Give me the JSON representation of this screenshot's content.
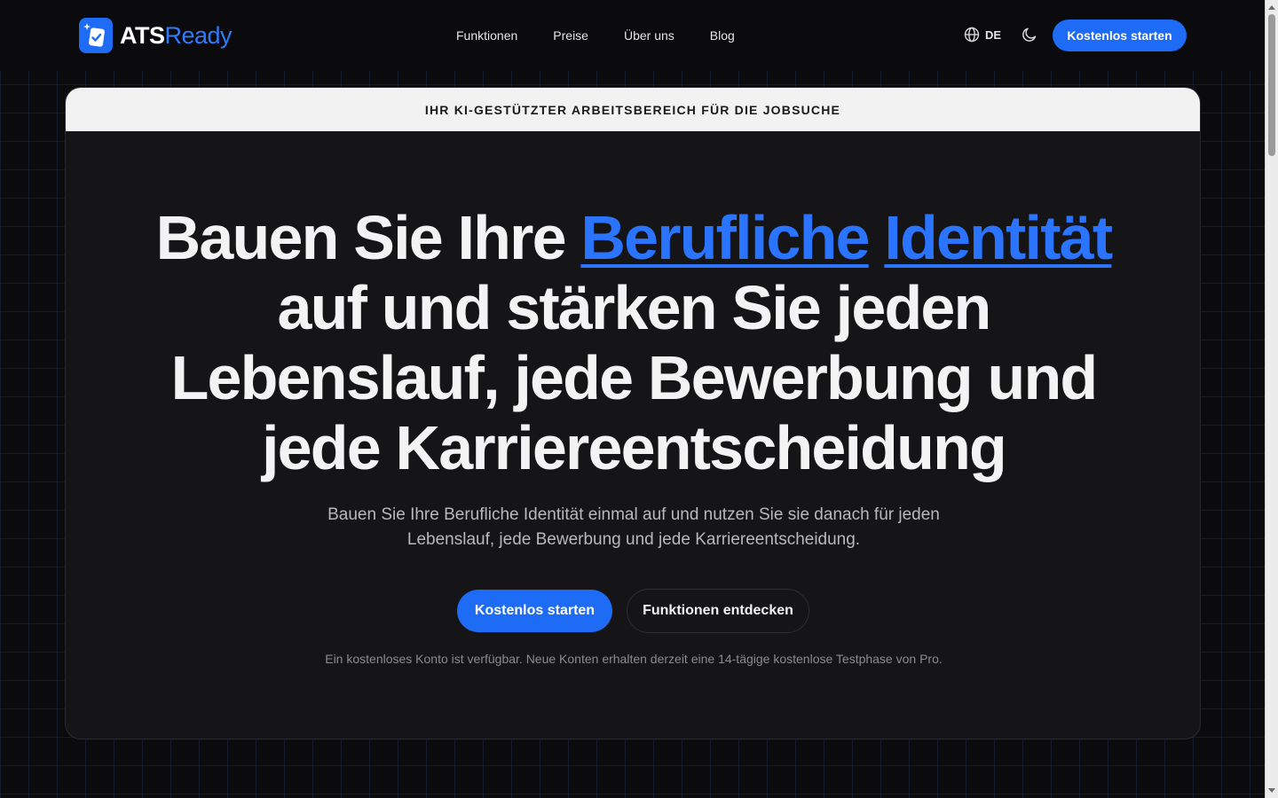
{
  "brand": {
    "name_part1": "ATS",
    "name_part2": "Ready"
  },
  "nav": {
    "links": [
      "Funktionen",
      "Preise",
      "Über uns",
      "Blog"
    ],
    "language": "DE",
    "cta": "Kostenlos starten"
  },
  "hero": {
    "banner": "IHR KI-GESTÜTZTER ARBEITSBEREICH FÜR DIE JOBSUCHE",
    "headline_pre": "Bauen Sie Ihre ",
    "headline_hl1": "Berufliche",
    "headline_hl2": "Identität",
    "headline_line2": "auf und stärken Sie jeden",
    "headline_line3": "Lebenslauf, jede Bewerbung und",
    "headline_line4": "jede Karriereentscheidung",
    "subtitle": "Bauen Sie Ihre Berufliche Identität einmal auf und nutzen Sie sie danach für jeden Lebenslauf, jede Bewerbung und jede Karriereentscheidung.",
    "primary_button": "Kostenlos starten",
    "secondary_button": "Funktionen entdecken",
    "note": "Ein kostenloses Konto ist verfügbar. Neue Konten erhalten derzeit eine 14-tägige kostenlose Testphase von Pro."
  },
  "colors": {
    "accent": "#1e6bf5",
    "background": "#0b0b0e",
    "card": "#151518"
  },
  "icons": {
    "language": "globe-icon",
    "theme": "moon-icon"
  }
}
